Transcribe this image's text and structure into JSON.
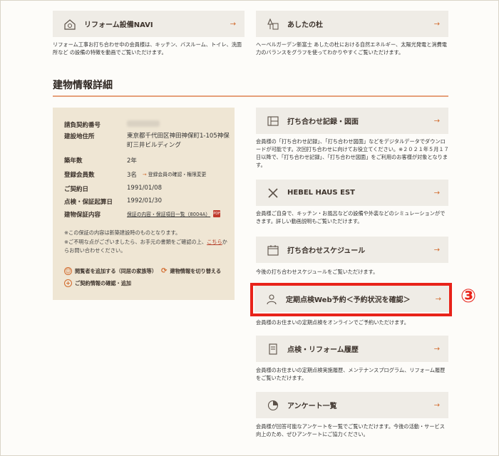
{
  "top_cards": [
    {
      "title": "リフォーム設備NAVI",
      "icon": "house-gear-icon",
      "desc": "リフォーム工事お打ち合わせ中の会員様は、キッチン、バスルーム、トイレ、洗面所など の設備の特徴を動画でご覧いただけます。"
    },
    {
      "title": "あしたの杜",
      "icon": "forest-building-icon",
      "desc": "ヘーベルガーデン新富士 あしたの杜における自然エネルギー、太陽光発電と消費電力のバランスをグラフを使ってわかりやすくご覧いただけます。"
    }
  ],
  "section_title": "建物情報詳細",
  "building_info": {
    "rows": [
      {
        "label": "請負契約番号",
        "value": ""
      },
      {
        "label": "建設地住所",
        "value": "東京都千代田区神田神保町1-105神保町三井ビルディング"
      },
      {
        "label": "築年数",
        "value": "2年"
      },
      {
        "label": "登録会員数",
        "value": "3名",
        "link": "登録会員の確認・権限変更"
      },
      {
        "label": "ご契約日",
        "value": "1991/01/08"
      },
      {
        "label": "点検・保証起算日",
        "value": "1992/01/30"
      },
      {
        "label": "建物保証内容",
        "value": "保証の内容・保証項目一覧（8004A）"
      }
    ],
    "note1": "※この保証の内容は新築建設時のものとなります。",
    "note2": "※ご不明な点がございましたら、お手元の書類をご確認の上、",
    "note2_link": "こちら",
    "note3": "からお問い合わせください。",
    "actions": [
      {
        "label": "閲覧者を追加する（同居の家族等）",
        "icon": "add-person-icon"
      },
      {
        "label": "建物情報を切り替える",
        "icon": "switch-icon"
      },
      {
        "label": "ご契約情報の確認・追加",
        "icon": "plus-icon"
      }
    ]
  },
  "right_cards": [
    {
      "title": "打ち合わせ記録・図面",
      "icon": "blueprint-icon",
      "desc": "会員様の「打ち合わせ記録」、「打ち合わせ図面」などをデジタルデータでダウンロードが可能です。次回打ち合わせに向けてお役立てください。※２０２１年５月１７日以降で、「打ち合わせ記録」、「打ち合わせ図面」をご利用のお客様が対象となります。"
    },
    {
      "title": "HEBEL HAUS EST",
      "icon": "tools-icon",
      "desc": "会員様ご自身で、キッチン・お風呂などの設備や外装などのシミュレーションができます。詳しい動画説明もご覧いただけます。"
    },
    {
      "title": "打ち合わせスケジュール",
      "icon": "calendar-icon",
      "desc": "今後の打ち合わせスケジュールをご覧いただけます。"
    },
    {
      "title": "定期点検Web予約＜予約状況を確認＞",
      "icon": "inspector-icon",
      "desc": "会員様のお住まいの定期点検をオンラインでご予約いただけます。"
    },
    {
      "title": "点検・リフォーム履歴",
      "icon": "history-icon",
      "desc": "会員様のお住まいの定期点検実施履歴、メンテナンスプログラム、リフォーム履歴をご覧いただけます。"
    },
    {
      "title": "アンケート一覧",
      "icon": "pie-chart-icon",
      "desc": "会員様が回答可能なアンケートを一覧でご覧いただけます。今後の活動・サービス向上のため、ぜひアンケートにご協力ください。"
    }
  ],
  "callout_number": "③",
  "colors": {
    "accent": "#d26a2c",
    "highlight": "#e8231a",
    "panel": "#efe6d4",
    "card": "#efece6"
  }
}
